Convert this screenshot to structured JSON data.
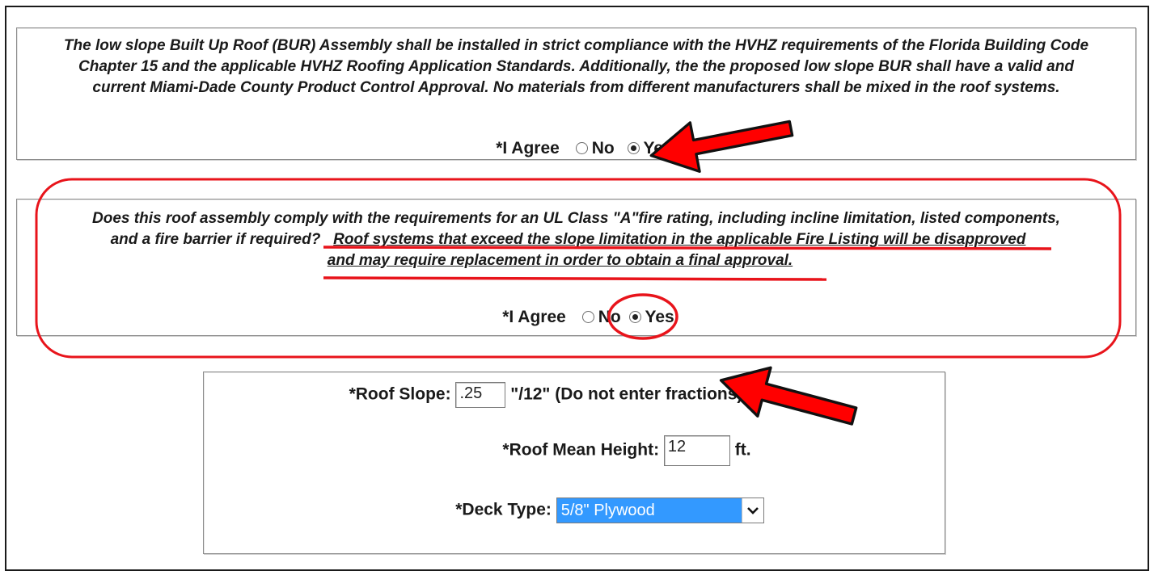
{
  "section1": {
    "statement_lines": [
      "The low slope Built Up Roof (BUR) Assembly shall be installed in strict compliance with the HVHZ requirements of the Florida Building Code",
      "Chapter 15 and the applicable HVHZ Roofing Application Standards.   Additionally, the the proposed low slope BUR shall have a valid and",
      "current Miami-Dade County Product Control Approval. No materials from different manufacturers shall be mixed in the roof systems."
    ],
    "agree_label": "*I Agree",
    "option_no": "No",
    "option_yes": "Yes",
    "selected": "Yes"
  },
  "section2": {
    "line1": "Does this roof assembly comply with the requirements for an UL Class \"A\"fire rating, including incline limitation, listed components,",
    "line2_prefix": "and a fire barrier if required?",
    "line2_underlined": "Roof systems that exceed the slope limitation in the applicable Fire Listing will be disapproved",
    "line3_underlined": "and may require replacement in order to obtain a final approval.",
    "agree_label": "*I Agree",
    "option_no": "No",
    "option_yes": "Yes",
    "selected": "Yes"
  },
  "roof_form": {
    "slope_label": "*Roof Slope:",
    "slope_value": ".25",
    "slope_unit": "\"/12\" (Do not enter fractions)",
    "height_label": "*Roof Mean Height:",
    "height_value": "12",
    "height_unit": "ft.",
    "deck_label": "*Deck Type:",
    "deck_value": "5/8\" Plywood"
  },
  "annotation_colors": {
    "arrow_fill": "#ff0000",
    "markup_red": "#e8141b"
  },
  "icons": {
    "arrow": "red-arrow-icon",
    "dropdown": "chevron-down-icon"
  }
}
